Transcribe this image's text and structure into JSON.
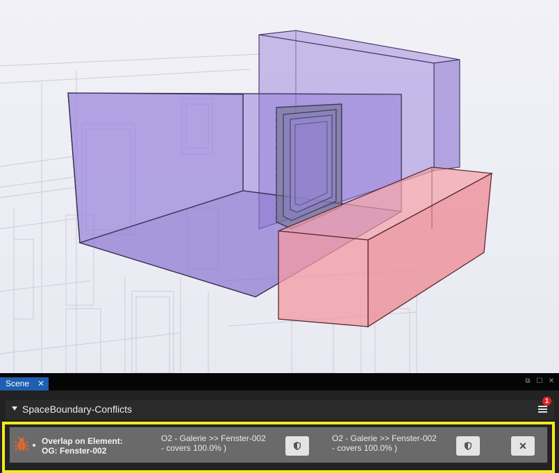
{
  "panel": {
    "tab_label": "Scene",
    "tab_close_glyph": "✕",
    "window_controls": {
      "float": "⧉",
      "maximize": "☐",
      "close": "✕"
    },
    "tree": {
      "title": "SpaceBoundary-Conflicts",
      "notification_count": "1"
    },
    "conflict": {
      "icon": "bug-icon",
      "type": "Overlap on Element:",
      "element": "OG: Fenster-002",
      "items": [
        {
          "line1": "O2 - Galerie >> Fenster-002",
          "line2": "- covers 100.0% )"
        },
        {
          "line1": "O2 - Galerie >> Fenster-002",
          "line2": "- covers 100.0% )"
        }
      ],
      "dismiss_glyph": "✕"
    }
  },
  "colors": {
    "space_volume": "#8f77d8",
    "conflict_volume": "#f08a95",
    "highlight": "#f4ea1c",
    "bug_icon": "#e8672a",
    "tab_active": "#1d5fb0",
    "badge": "#e02424"
  }
}
